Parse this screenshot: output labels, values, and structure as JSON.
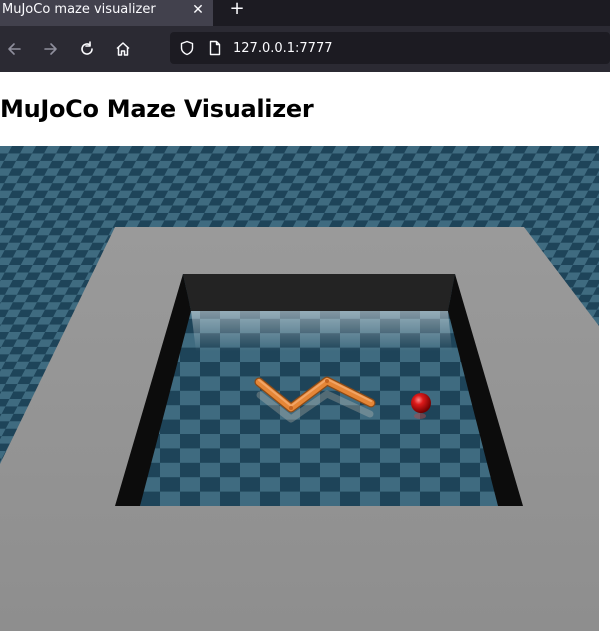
{
  "browser": {
    "tab_title": "MuJoCo maze visualizer",
    "tab_close_icon": "close-icon",
    "new_tab_icon": "plus-icon",
    "nav_icons": [
      "back-arrow-icon",
      "forward-arrow-icon",
      "reload-icon",
      "home-icon"
    ],
    "url": "127.0.0.1:7777",
    "url_icons": [
      "shield-icon",
      "page-icon"
    ]
  },
  "page": {
    "title": "MuJoCo Maze Visualizer"
  },
  "scene": {
    "description_icon": "3d-viewport",
    "colors": {
      "floor_dark": "#1e4459",
      "floor_light": "#3f6b80",
      "platform": "#999999",
      "wall": "#111111",
      "robot": "#e07f32",
      "target": "#cc1111"
    }
  }
}
